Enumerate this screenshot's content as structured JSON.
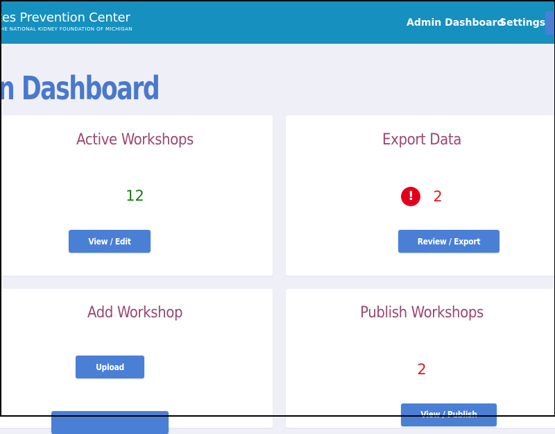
{
  "header": {
    "brand_title": "tes Prevention Center",
    "brand_subtitle": "THE NATIONAL KIDNEY FOUNDATION OF MICHIGAN",
    "nav": {
      "admin_dashboard": "Admin Dashboard",
      "settings": "Settings"
    },
    "colors": {
      "background": "#1590bf",
      "accent_button": "#4a7fd6"
    }
  },
  "page": {
    "title": "n Dashboard",
    "title_color": "#4a78cd",
    "background": "#eff0f7"
  },
  "cards": {
    "active_workshops": {
      "title": "Active Workshops",
      "count": "12",
      "count_color": "#1a7a1a",
      "button": "View / Edit"
    },
    "export_data": {
      "title": "Export Data",
      "count": "2",
      "count_color": "#e01919",
      "alert_icon": "exclamation-circle-icon",
      "alert_glyph": "!",
      "button": "Review / Export"
    },
    "add_workshop": {
      "title": "Add Workshop",
      "button": "Upload",
      "second_button": ""
    },
    "publish_workshops": {
      "title": "Publish Workshops",
      "count": "2",
      "count_color": "#e01919",
      "button": "View / Publish"
    }
  },
  "colors": {
    "card_title": "#9a4671",
    "button": "#4a7fd6"
  }
}
